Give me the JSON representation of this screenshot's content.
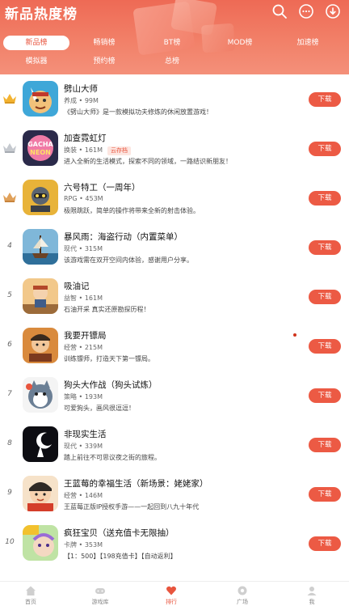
{
  "header": {
    "title": "新品热度榜",
    "tabs_row1": [
      "新品榜",
      "畅销榜",
      "BT榜",
      "MOD榜",
      "加速榜"
    ],
    "tabs_row2": [
      "模拟器",
      "预约榜",
      "总榜"
    ],
    "active_tab": "新品榜"
  },
  "apps": [
    {
      "rank": "1",
      "name": "劈山大师",
      "category": "养成",
      "size": "99M",
      "tag": "",
      "desc": "《劈山大师》是一款模拟功夫修炼的休闲放置游戏！",
      "button": "下载"
    },
    {
      "rank": "2",
      "name": "加查霓虹灯",
      "category": "换装",
      "size": "161M",
      "tag": "云存档",
      "desc": "进入全新的生活模式，探索不同的领域，一路结识新朋友！",
      "button": "下载"
    },
    {
      "rank": "3",
      "name": "六号特工（一周年）",
      "category": "RPG",
      "size": "453M",
      "tag": "",
      "desc": "极限跳跃，简单的操作将带来全新的射击体验。",
      "button": "下载"
    },
    {
      "rank": "4",
      "name": "暴风雨：海盗行动（内置菜单）",
      "category": "现代",
      "size": "315M",
      "tag": "",
      "desc": "该游戏需在双开空间内体验，感谢用户分享。",
      "button": "下载"
    },
    {
      "rank": "5",
      "name": "吸油记",
      "category": "益智",
      "size": "161M",
      "tag": "",
      "desc": "石油开采 真实还原勘探历程！",
      "button": "下载"
    },
    {
      "rank": "6",
      "name": "我要开镖局",
      "category": "经营",
      "size": "215M",
      "tag": "",
      "desc": "训练镖师，打造天下第一镖局。",
      "button": "下载"
    },
    {
      "rank": "7",
      "name": "狗头大作战（狗头试炼）",
      "category": "策略",
      "size": "193M",
      "tag": "",
      "desc": "可爱狗头，画风很逗逗！",
      "button": "下载"
    },
    {
      "rank": "8",
      "name": "非现实生活",
      "category": "现代",
      "size": "339M",
      "tag": "",
      "desc": "踏上前往不可思议夜之街的旅程。",
      "button": "下载"
    },
    {
      "rank": "9",
      "name": "王蓝莓的幸福生活（新场景：姥姥家）",
      "category": "经营",
      "size": "146M",
      "tag": "",
      "desc": "王蓝莓正版IP授权手游——一起回到八九十年代",
      "button": "下载"
    },
    {
      "rank": "10",
      "name": "疯狂宝贝（送充值卡无限抽）",
      "category": "卡牌",
      "size": "353M",
      "tag": "",
      "desc": "【1：500】【198充值卡】【自动返利】",
      "button": "下载"
    }
  ],
  "bottom_nav": [
    "首页",
    "游戏库",
    "排行",
    "广场",
    "我"
  ],
  "bottom_nav_active": "排行",
  "colors": {
    "accent": "#ec5a44",
    "header": "#ee6a55"
  }
}
